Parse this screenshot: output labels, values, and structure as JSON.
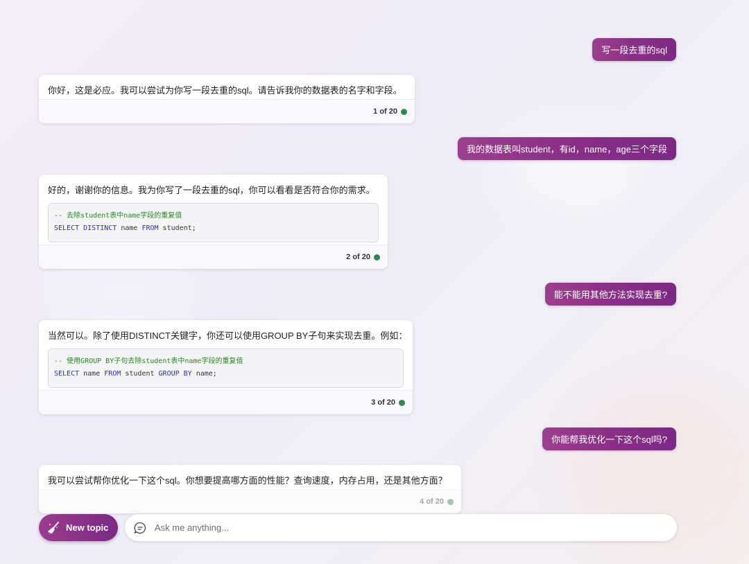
{
  "conversation": [
    {
      "role": "user",
      "text": "写一段去重的sql"
    },
    {
      "role": "bot",
      "text": "你好，这是必应。我可以尝试为你写一段去重的sql。请告诉我你的数据表的名字和字段。",
      "counter": "1 of 20"
    },
    {
      "role": "user",
      "text": "我的数据表叫student，有id，name，age三个字段"
    },
    {
      "role": "bot",
      "text": "好的，谢谢你的信息。我为你写了一段去重的sql，你可以看看是否符合你的需求。",
      "code": {
        "comment": "-- 去除student表中name字段的重复值",
        "tokens": [
          {
            "t": "SELECT DISTINCT",
            "kw": true
          },
          {
            "t": " name ",
            "kw": false
          },
          {
            "t": "FROM",
            "kw": true
          },
          {
            "t": " student;",
            "kw": false
          }
        ]
      },
      "counter": "2 of 20"
    },
    {
      "role": "user",
      "text": "能不能用其他方法实现去重?"
    },
    {
      "role": "bot",
      "text": "当然可以。除了使用DISTINCT关键字，你还可以使用GROUP BY子句来实现去重。例如：",
      "code": {
        "comment": "-- 使用GROUP BY子句去除student表中name字段的重复值",
        "tokens": [
          {
            "t": "SELECT",
            "kw": true
          },
          {
            "t": " name ",
            "kw": false
          },
          {
            "t": "FROM",
            "kw": true
          },
          {
            "t": " student ",
            "kw": false
          },
          {
            "t": "GROUP BY",
            "kw": true
          },
          {
            "t": " name;",
            "kw": false
          }
        ]
      },
      "counter": "3 of 20"
    },
    {
      "role": "user",
      "text": "你能帮我优化一下这个sql吗?"
    },
    {
      "role": "bot",
      "text": "我可以尝试帮你优化一下这个sql。你想要提高哪方面的性能？查询速度，内存占用，还是其他方面？",
      "counter": "4 of 20"
    }
  ],
  "new_topic": {
    "label": "New topic",
    "icon": "broom-icon"
  },
  "input": {
    "placeholder": "Ask me anything...",
    "value": "",
    "icon": "chat-bubble-icon"
  },
  "colors": {
    "user_bubble": "#8a2f86",
    "status_dot": "#2e8b4a",
    "keyword": "#2b2bd6",
    "comment": "#1f8a1f"
  }
}
